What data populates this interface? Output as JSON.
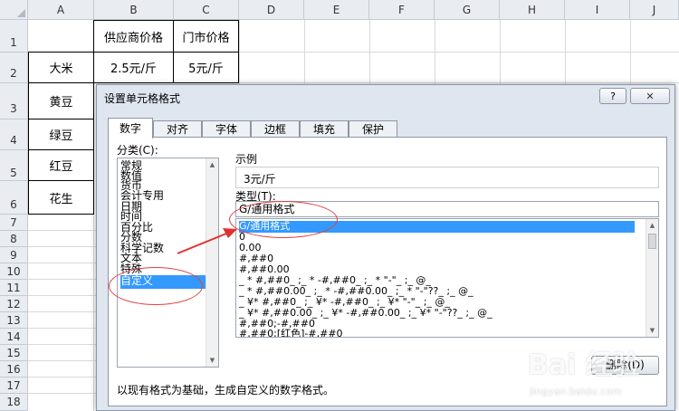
{
  "sheet": {
    "columns": [
      "A",
      "B",
      "C",
      "D",
      "E",
      "F",
      "G",
      "H",
      "I",
      "J"
    ],
    "rows": [
      "1",
      "2",
      "3",
      "4",
      "5",
      "6",
      "7",
      "8",
      "9",
      "10",
      "11",
      "12",
      "13",
      "14",
      "15",
      "16",
      "17",
      "18"
    ],
    "cells": {
      "b1": "供应商价格",
      "c1": "门市价格",
      "a2": "大米",
      "b2": "2.5元/斤",
      "c2": "5元/斤",
      "a3": "黄豆",
      "a4": "绿豆",
      "a5": "红豆",
      "a6": "花生",
      "c3_fragment": "元/斤"
    }
  },
  "dialog": {
    "title": "设置单元格格式",
    "help_label": "?",
    "close_label": "✕",
    "tabs": [
      "数字",
      "对齐",
      "字体",
      "边框",
      "填充",
      "保护"
    ],
    "active_tab": "数字",
    "category_label": "分类(C):",
    "categories": [
      "常规",
      "数值",
      "货币",
      "会计专用",
      "日期",
      "时间",
      "百分比",
      "分数",
      "科学记数",
      "文本",
      "特殊",
      "自定义"
    ],
    "selected_category": "自定义",
    "sample_label": "示例",
    "sample_value": "3元/斤",
    "type_label": "类型(T):",
    "type_value": "G/通用格式",
    "formats": [
      "G/通用格式",
      "0",
      "0.00",
      "#,##0",
      "#,##0.00",
      "_ * #,##0_ ;_ * -#,##0_ ;_ * \"-\"_ ;_ @_",
      "_ * #,##0.00_ ;_ * -#,##0.00_ ;_ * \"-\"??_ ;_ @_",
      "_ ¥* #,##0_ ;_ ¥* -#,##0_ ;_ ¥* \"-\"_ ;_ @_",
      "_ ¥* #,##0.00_ ;_ ¥* -#,##0.00_ ;_ ¥* \"-\"??_ ;_ @_",
      "#,##0;-#,##0",
      "#,##0;[红色]-#,##0"
    ],
    "delete_label": "删除(D)",
    "description": "以现有格式为基础，生成自定义的数字格式。"
  },
  "watermark": {
    "logo_text": "Bai 经验",
    "url": "jingyan.baidu.com"
  },
  "colors": {
    "selection": "#3399ff",
    "annotation": "#e04040",
    "header_bg": "#e9ecf1",
    "dialog_bg": "#dfe6ef"
  }
}
